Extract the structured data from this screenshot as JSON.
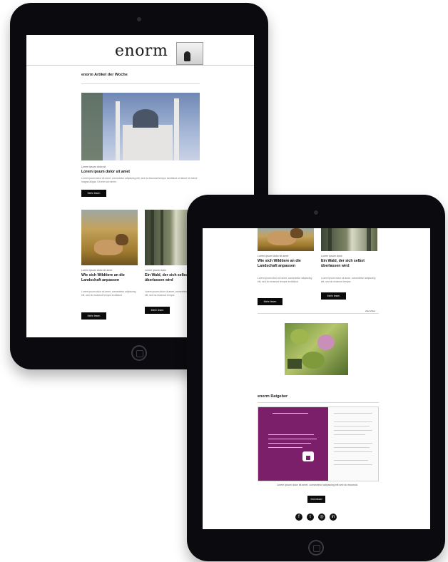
{
  "newsletter": {
    "logo": "enorm",
    "section_title": "enorm Artikel der Woche",
    "featured": {
      "category": "Lorem ipsum dolor sit",
      "title": "Lorem ipsum dolor sit amet",
      "body": "Lorem ipsum dolor sit amet, consectetur adipiscing elit, sed do eiusmod tempor incididunt ut labore et dolore magna aliqua. Ut enim ad minim.",
      "button": "Mehr lesen"
    },
    "articles": [
      {
        "category": "Lorem ipsum dolor sit amet",
        "title": "Wie sich Wildtiere an die Landschaft anpassen",
        "body": "Lorem ipsum dolor sit amet, consectetur adipiscing elit, sed do eiusmod tempor incididunt.",
        "button": "Mehr lesen"
      },
      {
        "category": "Lorem ipsum dolor",
        "title": "Ein Wald, der sich selbst überlassen wird",
        "body": "Lorem ipsum dolor sit amet, consectetur adipiscing elit, sed do eiusmod tempor.",
        "button": "Mehr lesen"
      }
    ],
    "more_link": "Alle Artikel",
    "report_section_title": "enorm Ratgeber",
    "report_button": "Download",
    "report_caption": "Lorem ipsum dolor sit amet, consectetur adipiscing elit sed do eiusmod."
  },
  "social_icons": [
    "facebook-icon",
    "twitter-icon",
    "instagram-icon",
    "linkedin-icon"
  ],
  "social_glyphs": [
    "f",
    "t",
    "◎",
    "in"
  ],
  "colors": {
    "device": "#0b0a0f",
    "button": "#0b0b0b",
    "report_accent": "#7b1f6a"
  }
}
